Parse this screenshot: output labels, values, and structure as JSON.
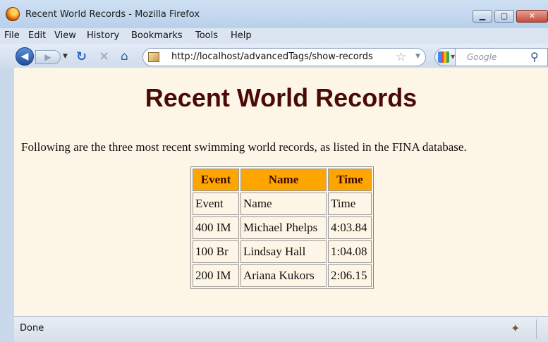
{
  "window": {
    "title": "Recent World Records - Mozilla Firefox"
  },
  "menubar": {
    "items": [
      "File",
      "Edit",
      "View",
      "History",
      "Bookmarks",
      "Tools",
      "Help"
    ]
  },
  "navbar": {
    "url": "http://localhost/advancedTags/show-records",
    "search_placeholder": "Google"
  },
  "page": {
    "title": "Recent World Records",
    "intro": "Following are the three most recent swimming world records, as listed in the FINA database.",
    "table": {
      "headers": [
        "Event",
        "Name",
        "Time"
      ],
      "rows": [
        [
          "Event",
          "Name",
          "Time"
        ],
        [
          "400 IM",
          "Michael Phelps",
          "4:03.84"
        ],
        [
          "100 Br",
          "Lindsay Hall",
          "1:04.08"
        ],
        [
          "200 IM",
          "Ariana Kukors",
          "2:06.15"
        ]
      ]
    }
  },
  "statusbar": {
    "text": "Done"
  },
  "colors": {
    "page_background": "#fdf5e6",
    "title": "#4a0a06",
    "header_background": "#ffa500"
  }
}
